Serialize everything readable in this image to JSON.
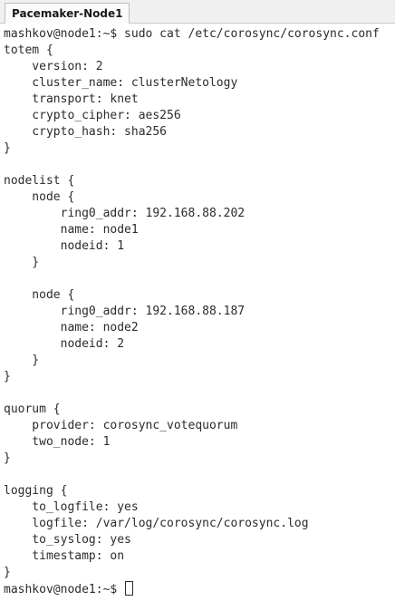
{
  "window": {
    "tab_title": "Pacemaker-Node1"
  },
  "terminal": {
    "lines": [
      "mashkov@node1:~$ sudo cat /etc/corosync/corosync.conf",
      "totem {",
      "    version: 2",
      "    cluster_name: clusterNetology",
      "    transport: knet",
      "    crypto_cipher: aes256",
      "    crypto_hash: sha256",
      "}",
      "",
      "nodelist {",
      "    node {",
      "        ring0_addr: 192.168.88.202",
      "        name: node1",
      "        nodeid: 1",
      "    }",
      "",
      "    node {",
      "        ring0_addr: 192.168.88.187",
      "        name: node2",
      "        nodeid: 2",
      "    }",
      "}",
      "",
      "quorum {",
      "    provider: corosync_votequorum",
      "    two_node: 1",
      "}",
      "",
      "logging {",
      "    to_logfile: yes",
      "    logfile: /var/log/corosync/corosync.log",
      "    to_syslog: yes",
      "    timestamp: on",
      "}"
    ],
    "prompt": "mashkov@node1:~$ "
  }
}
